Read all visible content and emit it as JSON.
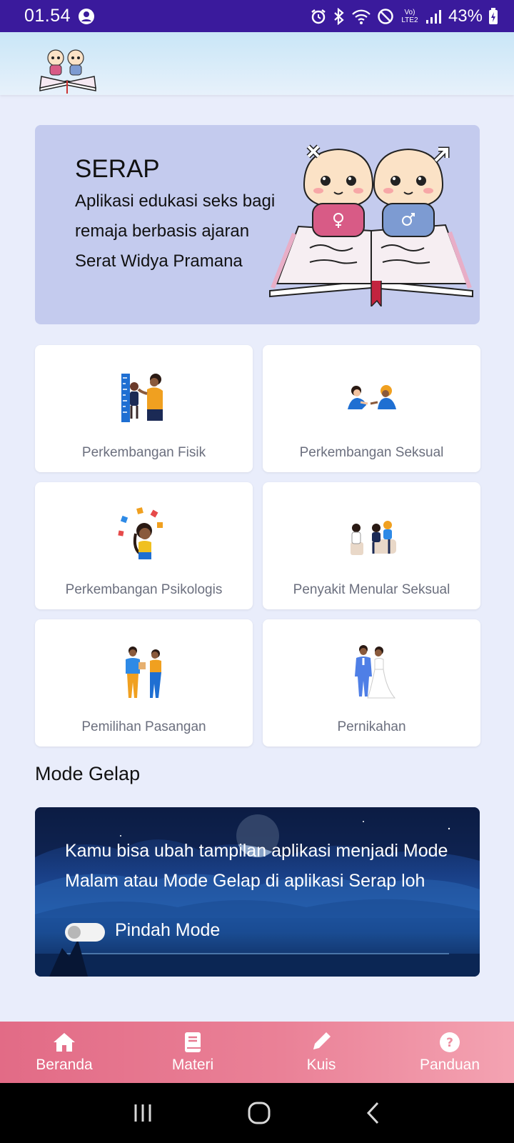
{
  "status_bar": {
    "time": "01.54",
    "battery": "43%",
    "network_label": "Vo) LTE2"
  },
  "hero": {
    "title": "SERAP",
    "subtitle": "Aplikasi edukasi seks bagi remaja berbasis ajaran Serat Widya Pramana"
  },
  "cards": [
    {
      "label": "Perkembangan Fisik",
      "icon": "physical-growth-illustration"
    },
    {
      "label": "Perkembangan Seksual",
      "icon": "sexual-development-illustration"
    },
    {
      "label": "Perkembangan Psikologis",
      "icon": "psychological-development-illustration"
    },
    {
      "label": "Penyakit Menular Seksual",
      "icon": "std-consultation-illustration"
    },
    {
      "label": "Pemilihan Pasangan",
      "icon": "partner-choice-illustration"
    },
    {
      "label": "Pernikahan",
      "icon": "wedding-illustration"
    }
  ],
  "dark_mode": {
    "section_title": "Mode Gelap",
    "description": "Kamu bisa ubah tampilan aplikasi menjadi Mode Malam atau Mode Gelap di aplikasi Serap loh",
    "toggle_label": "Pindah Mode",
    "toggle_on": false
  },
  "bottom_nav": [
    {
      "label": "Beranda",
      "icon": "home-icon"
    },
    {
      "label": "Materi",
      "icon": "book-icon"
    },
    {
      "label": "Kuis",
      "icon": "pencil-icon"
    },
    {
      "label": "Panduan",
      "icon": "help-icon"
    }
  ],
  "colors": {
    "status_bar": "#3a1a9c",
    "hero_bg": "#c4cbee",
    "page_bg": "#e9edfb",
    "nav_start": "#e26b86",
    "nav_end": "#f4a3b2"
  }
}
